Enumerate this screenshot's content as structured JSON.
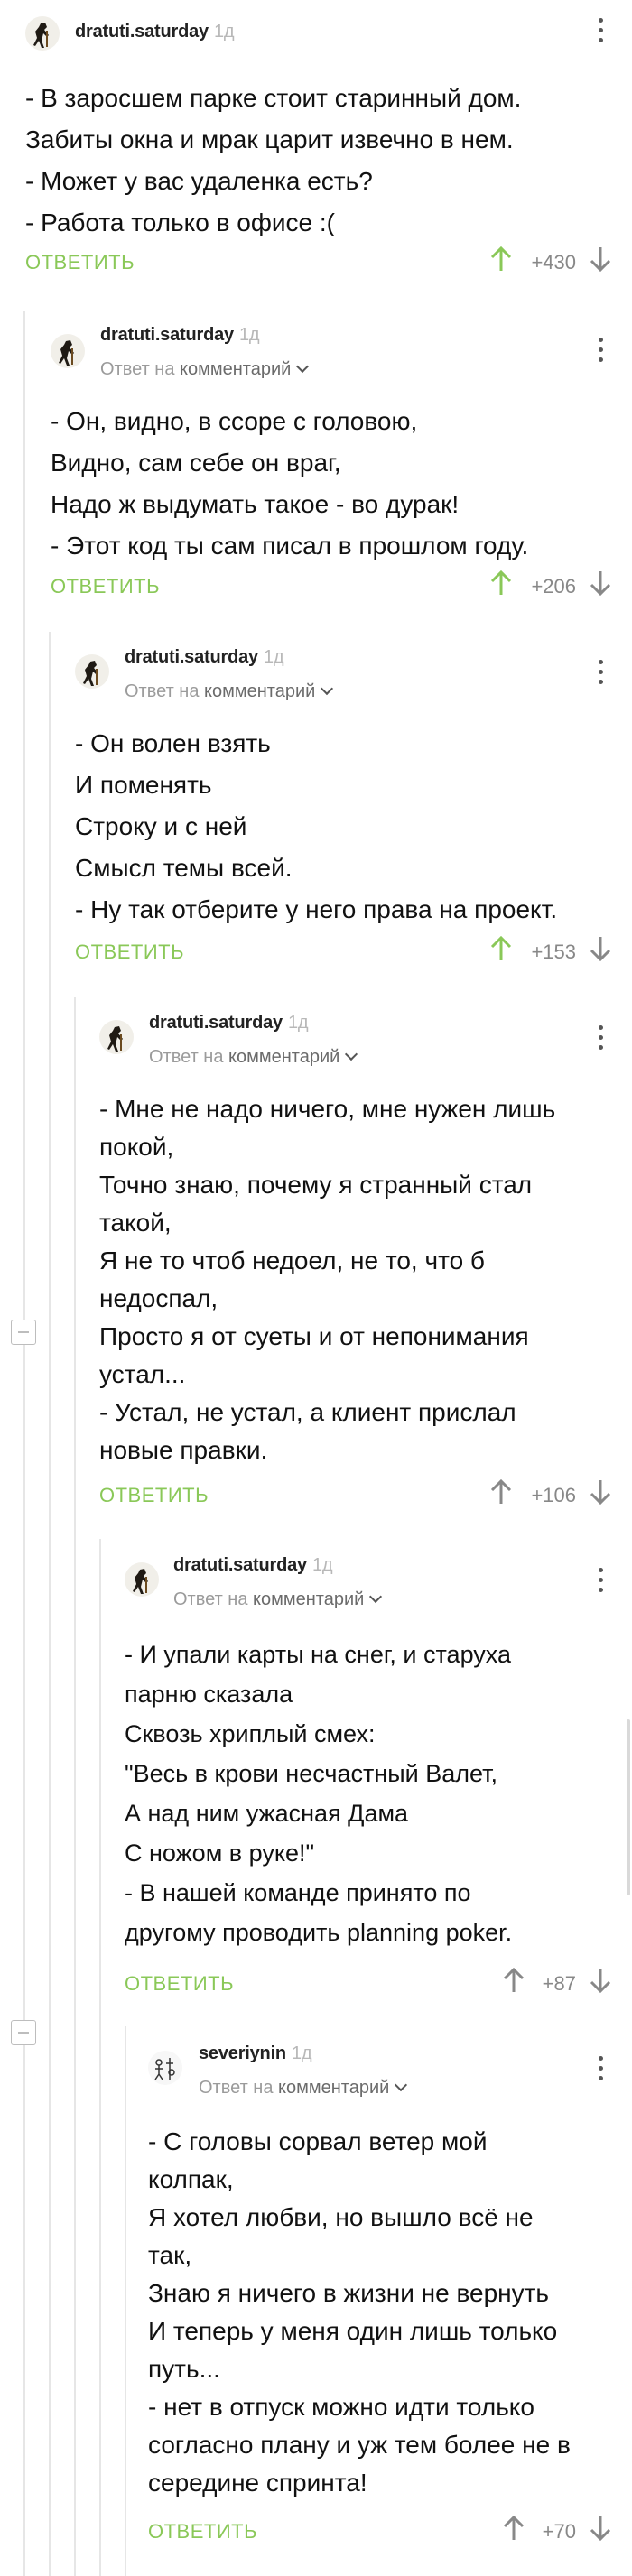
{
  "comments": [
    {
      "author": "dratuti.saturday",
      "age": "1д",
      "lines": [
        "- В заросшем парке стоит старинный дом.",
        "Забиты окна и мрак царит извечно в нем.",
        "- Может у вас удаленка есть?",
        "- Работа только в офисе :("
      ],
      "reply_label": "ОТВЕТИТЬ",
      "score": "+430"
    },
    {
      "author": "dratuti.saturday",
      "age": "1д",
      "reply_prefix": "Ответ на",
      "reply_link": "комментарий",
      "lines": [
        "- Он, видно, в ссоре с головою,",
        "Видно, сам себе он враг,",
        "Надо ж выдумать такое - во дурак!",
        "- Этот код ты сам писал в прошлом году."
      ],
      "reply_label": "ОТВЕТИТЬ",
      "score": "+206"
    },
    {
      "author": "dratuti.saturday",
      "age": "1д",
      "reply_prefix": "Ответ на",
      "reply_link": "комментарий",
      "lines": [
        "- Он волен взять",
        "И поменять",
        "Строку и с ней",
        "Смысл темы всей.",
        "- Ну так отберите у него права на проект."
      ],
      "reply_label": "ОТВЕТИТЬ",
      "score": "+153"
    },
    {
      "author": "dratuti.saturday",
      "age": "1д",
      "reply_prefix": "Ответ на",
      "reply_link": "комментарий",
      "lines": [
        "- Мне не надо ничего, мне нужен лишь",
        "покой,",
        "Точно знаю, почему я странный стал",
        "такой,",
        "Я не то чтоб недоел, не то, что б",
        "недоспал,",
        "Просто я от суеты и от непонимания",
        "устал...",
        "- Устал, не устал, а клиент прислал",
        "новые правки."
      ],
      "reply_label": "ОТВЕТИТЬ",
      "score": "+106"
    },
    {
      "author": "dratuti.saturday",
      "age": "1д",
      "reply_prefix": "Ответ на",
      "reply_link": "комментарий",
      "lines": [
        "- И упали карты на снег, и старуха",
        "парню сказала",
        "Сквозь хриплый смех:",
        "\"Весь в крови несчастный Валет,",
        "А над ним ужасная Дама",
        "С ножом в руке!\"",
        "- В нашей команде принято по",
        "другому проводить planning poker."
      ],
      "reply_label": "ОТВЕТИТЬ",
      "score": "+87"
    },
    {
      "author": "severiynin",
      "age": "1д",
      "reply_prefix": "Ответ на",
      "reply_link": "комментарий",
      "lines": [
        "- С головы сорвал ветер мой",
        "колпак,",
        "Я хотел любви, но вышло всё не",
        "так,",
        "Знаю я ничего в жизни не вернуть",
        "И теперь у меня один лишь только",
        "путь...",
        "- нет в отпуск можно идти только",
        "согласно плану и уж тем более не в",
        "середине спринта!"
      ],
      "reply_label": "ОТВЕТИТЬ",
      "score": "+70"
    }
  ],
  "colors": {
    "accent": "#8ac858",
    "muted": "#9b9b9b",
    "rail": "#e6e6e6"
  }
}
